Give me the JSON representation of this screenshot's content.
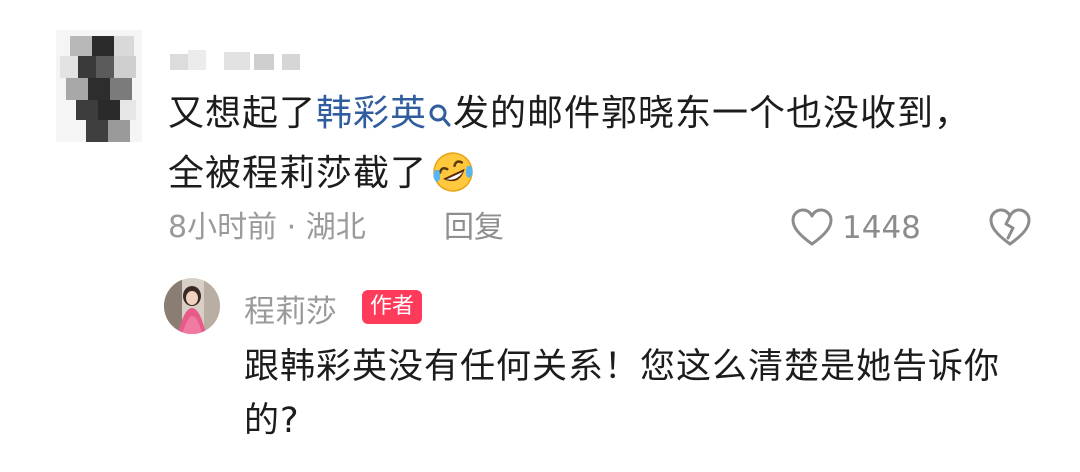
{
  "comment": {
    "text_parts": {
      "before": "又想起了",
      "mention": "韩彩英",
      "after": "发的邮件郭晓东一个也没收到，全被程莉莎截了"
    },
    "emoji_icon": "rolling-on-floor-laughing-emoji",
    "time_location": "8小时前 · 湖北",
    "reply_label": "回复",
    "like_count": "1448",
    "like_icon": "heart-outline-icon",
    "dislike_icon": "broken-heart-icon"
  },
  "reply": {
    "author_name": "程莉莎",
    "badge": "作者",
    "text": "跟韩彩英没有任何关系！您这么清楚是她告诉你的?"
  },
  "colors": {
    "mention": "#2f5d9e",
    "badge_bg": "#ff3b5c",
    "meta_text": "#9a9a9a"
  }
}
